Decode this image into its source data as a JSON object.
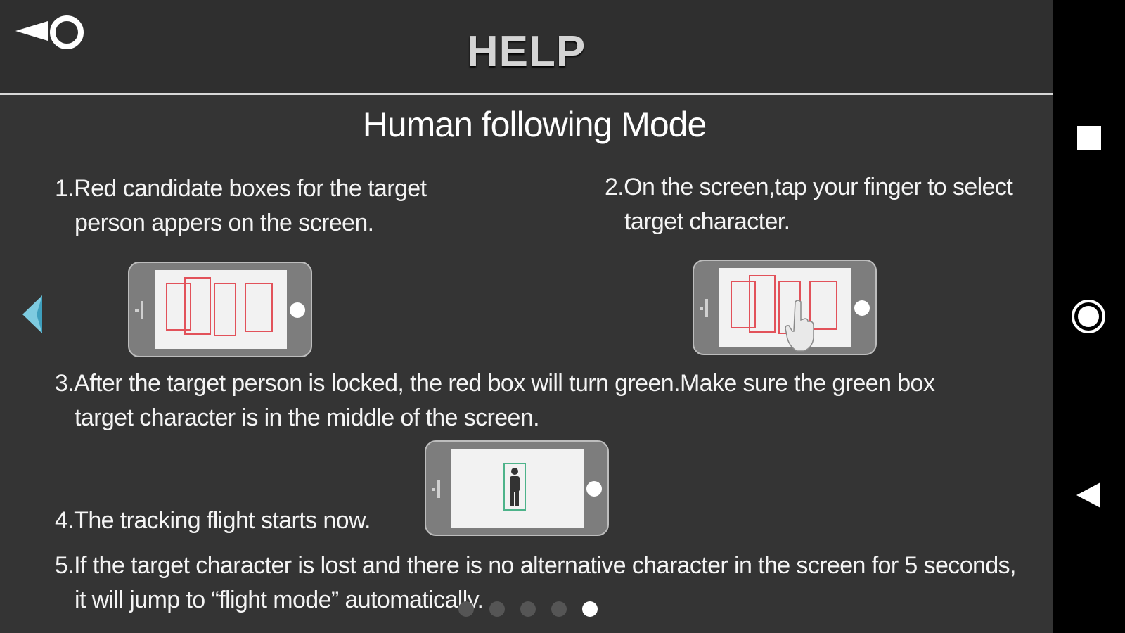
{
  "header": {
    "title": "HELP"
  },
  "section": {
    "title": "Human following Mode"
  },
  "steps": [
    {
      "line1": "1.Red candidate boxes for the target",
      "line2": "person appers on the screen."
    },
    {
      "line1": "2.On the screen,tap your finger to select",
      "line2": "target character."
    },
    {
      "line1": "3.After the target person is locked, the red box will turn green.Make sure the green box",
      "line2": "target character is in the middle of the screen."
    },
    {
      "line1": "4.The tracking flight starts now."
    },
    {
      "line1": "5.If the target character is lost and there is no alternative character in the screen for 5 seconds,",
      "line2": "it will jump to “flight mode” automatically."
    }
  ],
  "pager": {
    "page_count": 5,
    "active_page": 5
  },
  "colors": {
    "background": "#343434",
    "header_background": "#2f2f2f",
    "candidate_box": "#e2525a",
    "locked_box": "#4db38a",
    "arrow_accent": "#7ecbe0"
  },
  "icons": {
    "back": "back-arrow-circle-icon",
    "prev": "chevron-left-icon",
    "nav_recents": "square-icon",
    "nav_home": "circle-icon",
    "nav_back": "triangle-left-icon"
  }
}
